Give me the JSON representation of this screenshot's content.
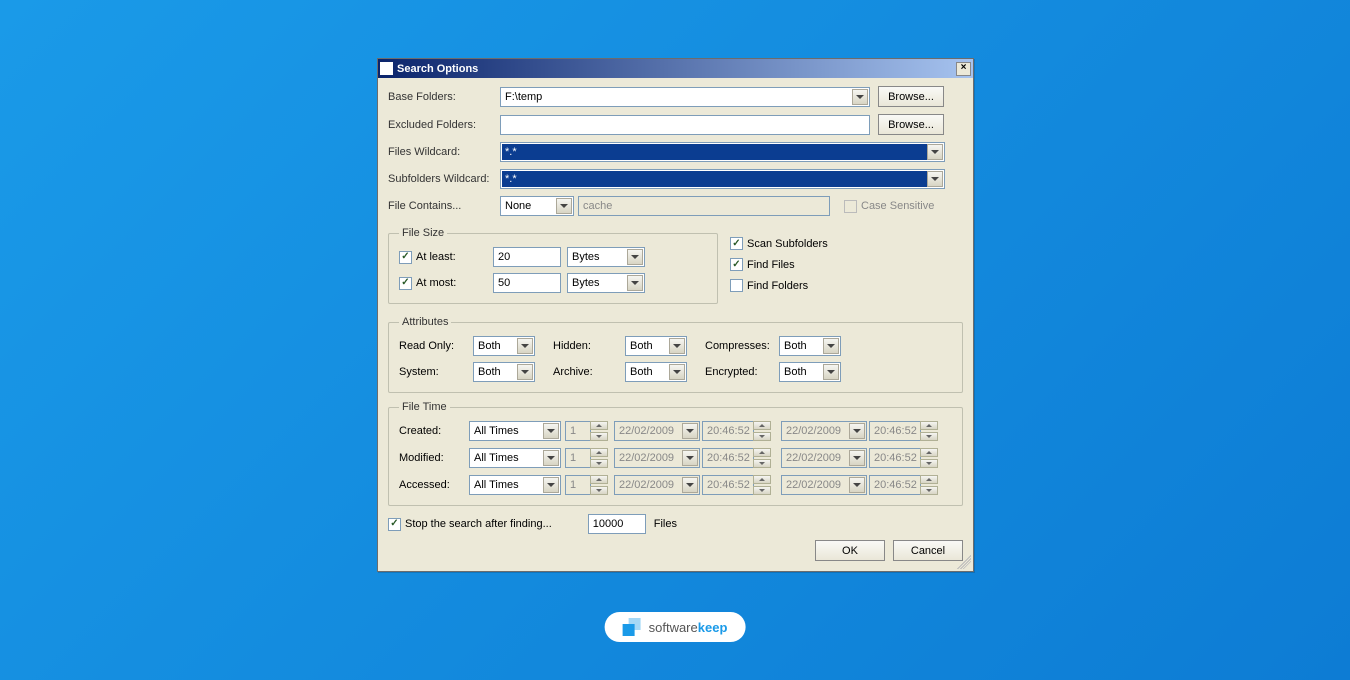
{
  "window": {
    "title": "Search Options"
  },
  "labels": {
    "base_folders": "Base Folders:",
    "excluded_folders": "Excluded Folders:",
    "files_wildcard": "Files Wildcard:",
    "subfolders_wildcard": "Subfolders Wildcard:",
    "file_contains": "File Contains...",
    "case_sensitive": "Case Sensitive",
    "file_size": "File Size",
    "at_least": "At least:",
    "at_most": "At most:",
    "scan_subfolders": "Scan Subfolders",
    "find_files": "Find Files",
    "find_folders": "Find Folders",
    "attributes": "Attributes",
    "read_only": "Read Only:",
    "hidden": "Hidden:",
    "compresses": "Compresses:",
    "system": "System:",
    "archive": "Archive:",
    "encrypted": "Encrypted:",
    "file_time": "File Time",
    "created": "Created:",
    "modified": "Modified:",
    "accessed": "Accessed:",
    "stop_after": "Stop the search after finding...",
    "files_suffix": "Files",
    "browse": "Browse...",
    "ok": "OK",
    "cancel": "Cancel"
  },
  "values": {
    "base_folders": "F:\\temp",
    "excluded_folders": "",
    "files_wildcard": "*.*",
    "subfolders_wildcard": "*.*",
    "file_contains_mode": "None",
    "file_contains_text": "cache",
    "at_least_val": "20",
    "at_most_val": "50",
    "size_unit": "Bytes",
    "attr_value": "Both",
    "time_mode": "All Times",
    "time_spin1": "1",
    "time_date": "22/02/2009",
    "time_time": "20:46:52",
    "stop_count": "10000"
  },
  "checked": {
    "at_least": true,
    "at_most": true,
    "scan_subfolders": true,
    "find_files": true,
    "find_folders": false,
    "case_sensitive": false,
    "stop_after": true
  },
  "watermark": {
    "prefix": "software",
    "suffix": "keep"
  }
}
